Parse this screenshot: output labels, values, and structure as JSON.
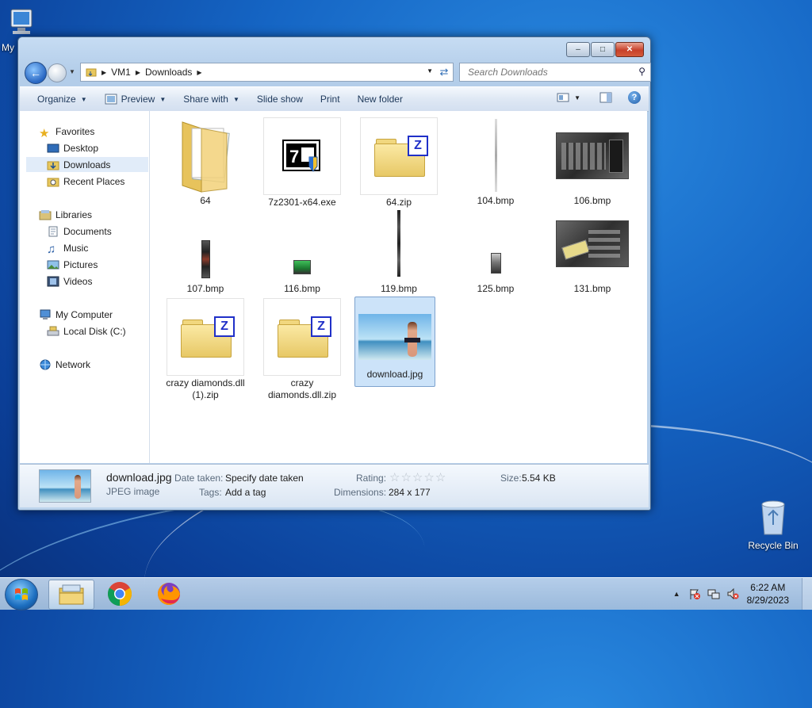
{
  "desktop": {
    "computer_label": "My",
    "recycle_bin_label": "Recycle Bin"
  },
  "window": {
    "address": {
      "crumbs": [
        "VM1",
        "Downloads"
      ]
    },
    "search": {
      "placeholder": "Search Downloads"
    },
    "toolbar": {
      "organize": "Organize",
      "preview": "Preview",
      "share_with": "Share with",
      "slide_show": "Slide show",
      "print": "Print",
      "new_folder": "New folder"
    },
    "nav": {
      "favorites": "Favorites",
      "desktop": "Desktop",
      "downloads": "Downloads",
      "recent_places": "Recent Places",
      "libraries": "Libraries",
      "documents": "Documents",
      "music": "Music",
      "pictures": "Pictures",
      "videos": "Videos",
      "my_computer": "My Computer",
      "local_disk": "Local Disk (C:)",
      "network": "Network"
    },
    "files": [
      {
        "name": "64"
      },
      {
        "name": "7z2301-x64.exe"
      },
      {
        "name": "64.zip"
      },
      {
        "name": "104.bmp"
      },
      {
        "name": "106.bmp"
      },
      {
        "name": "107.bmp"
      },
      {
        "name": "116.bmp"
      },
      {
        "name": "119.bmp"
      },
      {
        "name": "125.bmp"
      },
      {
        "name": "131.bmp"
      },
      {
        "name": "crazy diamonds.dll (1).zip"
      },
      {
        "name": "crazy diamonds.dll.zip"
      },
      {
        "name": "download.jpg"
      }
    ],
    "details": {
      "filename": "download.jpg",
      "filetype": "JPEG image",
      "date_taken_label": "Date taken:",
      "date_taken_value": "Specify date taken",
      "tags_label": "Tags:",
      "tags_value": "Add a tag",
      "rating_label": "Rating:",
      "rating_stars": 0,
      "dimensions_label": "Dimensions:",
      "dimensions_value": "284 x 177",
      "size_label": "Size:",
      "size_value": "5.54 KB"
    }
  },
  "taskbar": {
    "time": "6:22 AM",
    "date": "8/29/2023"
  },
  "colors": {
    "desktop_blue": "#1565c4",
    "selection": "#cce3f9",
    "close_red": "#c7412a"
  }
}
